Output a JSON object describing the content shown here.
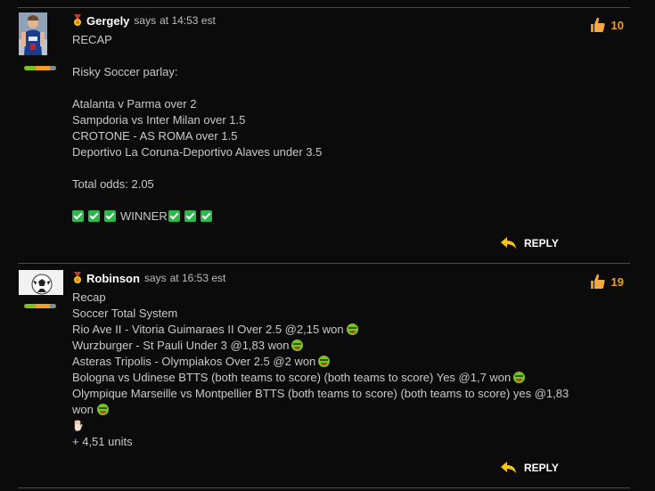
{
  "comments": [
    {
      "author": "Gergely",
      "says": "says",
      "time": "at 14:53 est",
      "likes": "10",
      "reply": "REPLY",
      "lines": [
        "RECAP",
        "",
        "Risky Soccer parlay:",
        "",
        "Atalanta v Parma over 2",
        "Sampdoria vs Inter Milan over 1.5",
        "CROTONE - AS ROMA over 1.5",
        "Deportivo La Coruna-Deportivo Alaves under 3.5",
        "",
        "Total odds: 2.05",
        ""
      ],
      "winner": "WINNER",
      "avatar": "basketball-player-avatar"
    },
    {
      "author": "Robinson",
      "says": "says",
      "time": "at 16:53 est",
      "likes": "19",
      "reply": "REPLY",
      "lines": [
        "Recap",
        "Soccer Total System",
        "Rio Ave II - Vitoria Guimaraes II Over 2.5 @2,15 won",
        "Wurzburger - St Pauli Under 3 @1,83 won",
        "Asteras Tripolis - Olympiakos Over 2.5 @2 won",
        "Bologna vs Udinese BTTS (both teams to score) (both teams to score) Yes @1,7 won",
        "Olympique Marseille vs Montpellier BTTS (both teams to score) (both teams to score) yes @1,83",
        "won",
        "",
        "+ 4,51 units"
      ],
      "avatar": "soccer-ball-avatar"
    }
  ],
  "colors": {
    "background": "#0b0b0b",
    "accent": "#f0a020",
    "check": "#2db84a"
  }
}
